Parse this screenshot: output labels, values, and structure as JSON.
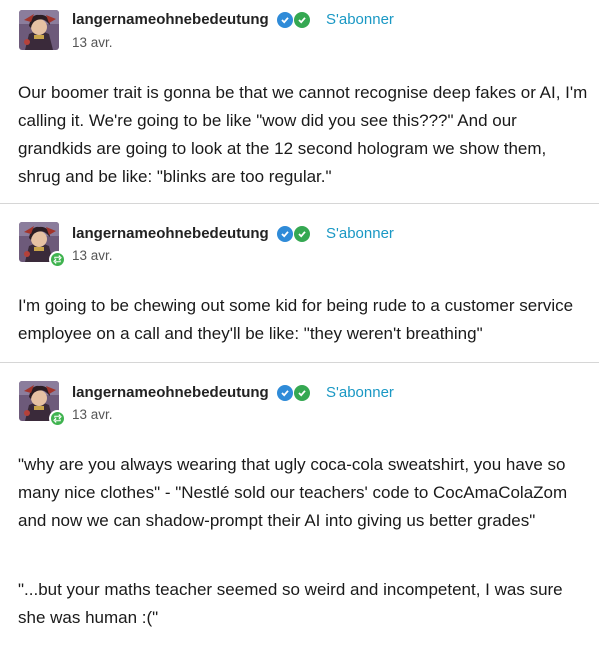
{
  "posts": [
    {
      "username": "langernameohnebedeutung",
      "follow_label": "S'abonner",
      "date": "13 avr.",
      "reblog": false,
      "paragraphs": [
        "Our boomer trait is gonna be that we cannot recognise deep fakes or AI, I'm calling it. We're going to be like \"wow did you see this???\" And our grandkids are going to look at the 12 second hologram we show them, shrug and be like: \"blinks are too regular.\""
      ]
    },
    {
      "username": "langernameohnebedeutung",
      "follow_label": "S'abonner",
      "date": "13 avr.",
      "reblog": true,
      "paragraphs": [
        "I'm going to be chewing out some kid for being rude to a customer service employee on a call and they'll be like: \"they weren't breathing\""
      ]
    },
    {
      "username": "langernameohnebedeutung",
      "follow_label": "S'abonner",
      "date": "13 avr.",
      "reblog": true,
      "paragraphs": [
        "\"why are you always wearing that ugly coca-cola sweatshirt, you have so many nice clothes\" - \"Nestlé sold our teachers' code to CocAmaColaZom and now we can shadow-prompt their AI into giving us better grades\"",
        "\"...but your maths teacher seemed so weird and incompetent, I was sure she was human :(\""
      ]
    }
  ],
  "colors": {
    "follow": "#1a98c4",
    "verified_blue": "#2f8bd8",
    "verified_green": "#35a852",
    "reblog_green": "#3fb34f",
    "divider": "#d6d6d6"
  },
  "icons": {
    "verified": "verified-badge-icon",
    "checkmark": "checkmark-badge-icon",
    "reblog": "reblog-icon"
  }
}
